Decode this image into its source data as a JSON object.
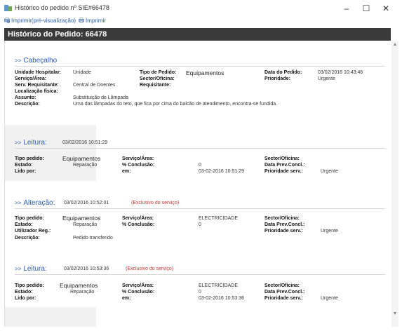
{
  "window": {
    "title": "Histórico do pedido nº SIE#66478",
    "minimize": "–",
    "maximize": "☐",
    "close": "✕"
  },
  "toolbar": {
    "print_preview": "Imprimir(pré-visualização)",
    "print": "Imprimir"
  },
  "header": {
    "title": "Histórico do Pedido: 66478"
  },
  "cabecalho": {
    "title": "Cabeçalho",
    "fields": {
      "unidade_label": "Unidade Hospitalar:",
      "unidade_value": "Unidade",
      "servico_label": "Serviço/Área:",
      "serv_req_label": "Serv. Requisitante:",
      "serv_req_value": "Central de Doentes",
      "localizacao_label": "Localização física:",
      "assunto_label": "Assunto:",
      "assunto_value": "Substituição de Lâmpada",
      "descricao_label": "Descrição:",
      "descricao_value": "Uma das lâmpadas do teto, que fica por cima do balcão de atendimento, encontra-se fundida.",
      "tipo_label": "Tipo de Pedido:",
      "tipo_value": "Equipamentos",
      "sector_label": "Sector/Oficina:",
      "requisitante_label": "Requisitante:",
      "data_label": "Data do Pedido:",
      "data_value": "03/02/2016 10:43:46",
      "prioridade_label": "Prioridade:",
      "prioridade_value": "Urgente"
    }
  },
  "entries": [
    {
      "title": "Leitura:",
      "datetime": "03/02/2016 10:51:29",
      "exclusive": "",
      "tipo_label": "Tipo pedido:",
      "tipo_value": "Equipamentos",
      "estado_label": "Estado:",
      "estado_value": "Reparação",
      "row3_label": "Lido por:",
      "row3_value": "",
      "servico_label": "Serviço/Área:",
      "servico_value": "",
      "conclusao_label": "% Conclusão:",
      "conclusao_value": "0",
      "em_label": "em:",
      "em_value": "03-02-2016 10:51:29",
      "sector_label": "Sector/Oficina:",
      "dataprev_label": "Data Prev.Concl.:",
      "prioridade_label": "Prioridade serv.:",
      "prioridade_value": "Urgente"
    },
    {
      "title": "Alteração:",
      "datetime": "03/02/2016 10:52:01",
      "exclusive": "(Exclusivo do serviço)",
      "tipo_label": "Tipo pedido:",
      "tipo_value": "Equipamentos",
      "estado_label": "Estado:",
      "estado_value": "Reparação",
      "row3_label": "Utilizador Reg.:",
      "row3_value": "",
      "descricao_label": "Descrição:",
      "descricao_value": "Pedido transferido",
      "servico_label": "Serviço/Área:",
      "servico_value": "ELECTRICIDADE",
      "conclusao_label": "% Conclusão:",
      "conclusao_value": "0",
      "sector_label": "Sector/Oficina:",
      "dataprev_label": "Data Prev.Concl.:",
      "prioridade_label": "Prioridade serv.:",
      "prioridade_value": "Urgente"
    },
    {
      "title": "Leitura:",
      "datetime": "03/02/2016 10:53:36",
      "exclusive": "(Exclusivo do serviço)",
      "tipo_label": "Tipo pedido:",
      "tipo_value": "Equipamentos",
      "estado_label": "Estado:",
      "estado_value": "Reparação",
      "row3_label": "Lido por:",
      "row3_value": "",
      "servico_label": "Serviço/Área:",
      "servico_value": "ELECTRICIDADE",
      "conclusao_label": "% Conclusão:",
      "conclusao_value": "0",
      "em_label": "em:",
      "em_value": "03-02-2016 10:53:36",
      "sector_label": "Sector/Oficina:",
      "dataprev_label": "Data Prev.Concl.:",
      "prioridade_label": "Prioridade serv.:",
      "prioridade_value": "Urgente"
    }
  ],
  "section_arrow": ">>",
  "colors": {
    "header_bg": "#3a3a3a",
    "link_blue": "#2a5db0",
    "exclusive_red": "#d03030"
  },
  "icons": [
    "app-icon",
    "print-preview-icon",
    "print-icon",
    "scroll-up-icon",
    "scroll-down-icon"
  ]
}
